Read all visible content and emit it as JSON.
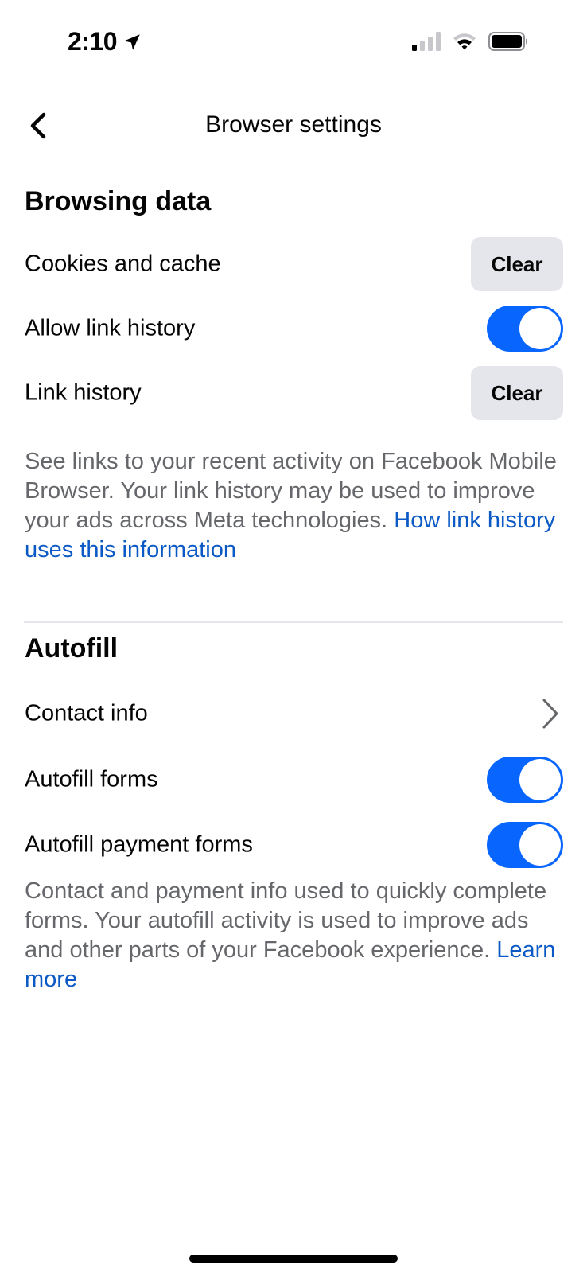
{
  "status_bar": {
    "time": "2:10",
    "location_icon": "location-arrow-icon",
    "signal_icon": "cellular-signal-icon",
    "wifi_icon": "wifi-icon",
    "battery_icon": "battery-icon"
  },
  "nav": {
    "back_icon": "chevron-left-icon",
    "title": "Browser settings"
  },
  "browsing_data": {
    "title": "Browsing data",
    "rows": [
      {
        "label": "Cookies and cache",
        "control": "button",
        "button_label": "Clear"
      },
      {
        "label": "Allow link history",
        "control": "toggle",
        "on": true
      },
      {
        "label": "Link history",
        "control": "button",
        "button_label": "Clear"
      }
    ],
    "description": "See links to your recent activity on Facebook Mobile Browser. Your link history may be used to improve your ads across Meta technologies.",
    "link": "How link history uses this information"
  },
  "autofill": {
    "title": "Autofill",
    "rows": [
      {
        "label": "Contact info",
        "control": "chevron"
      },
      {
        "label": "Autofill forms",
        "control": "toggle",
        "on": true
      },
      {
        "label": "Autofill payment forms",
        "control": "toggle",
        "on": true
      }
    ],
    "description": "Contact and payment info used to quickly complete forms. Your autofill activity is used to improve ads and other parts of your Facebook experience.",
    "link": "Learn more"
  },
  "colors": {
    "accent": "#0866ff",
    "link": "#0a59c4",
    "button_bg": "#e4e6eb",
    "secondary_text": "#65676b"
  }
}
